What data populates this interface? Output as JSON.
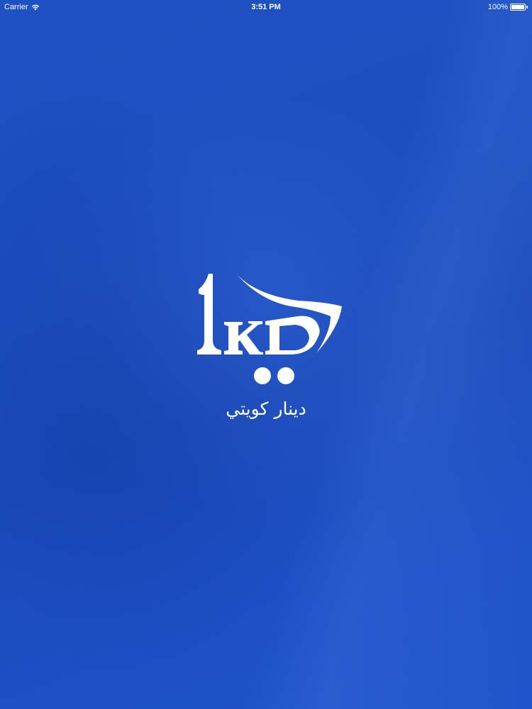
{
  "status_bar": {
    "carrier": "Carrier",
    "time": "3:51 PM",
    "battery_percent": "100%",
    "battery_level": 1.0,
    "wifi_icon": "wifi-icon",
    "battery_icon": "battery-icon"
  },
  "splash": {
    "logo_icon": "1kd-logo",
    "subtitle": "دينار كويتي"
  },
  "colors": {
    "background": "#1e50c3",
    "foreground": "#ffffff"
  }
}
